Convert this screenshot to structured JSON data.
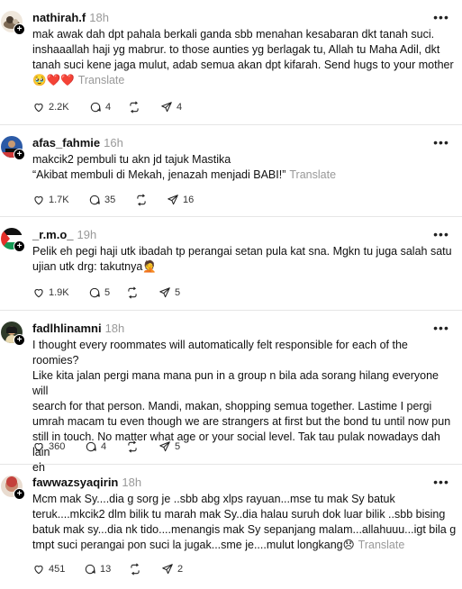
{
  "posts": [
    {
      "username": "nathirah.f",
      "time": "18h",
      "lines": [
        "mak awak dah dpt pahala berkali ganda sbb menahan kesabaran dkt tanah suci.",
        "inshaaallah haji yg mabrur. to those aunties yg berlagak tu, Allah tu Maha Adil, dkt",
        "tanah suci kene jaga mulut, adab semua akan dpt kifarah. Send hugs to your mother"
      ],
      "last_line": "🥹❤️❤️",
      "translate": "Translate",
      "likes": "2.2K",
      "replies": "4",
      "reposts": "",
      "shares": "4"
    },
    {
      "username": "afas_fahmie",
      "time": "16h",
      "lines": [
        "makcik2 pembuli tu akn jd tajuk Mastika"
      ],
      "last_line": "“Akibat membuli di Mekah, jenazah menjadi BABI!”",
      "translate": "Translate",
      "likes": "1.7K",
      "replies": "35",
      "reposts": "",
      "shares": "16"
    },
    {
      "username": "_r.m.o_",
      "time": "19h",
      "lines": [
        "Pelik eh pegi haji utk ibadah tp perangai setan pula kat sna. Mgkn tu juga salah satu"
      ],
      "last_line": "ujian utk drg: takutnya🤦",
      "translate": "",
      "likes": "1.9K",
      "replies": "5",
      "reposts": "",
      "shares": "5"
    },
    {
      "username": "fadlhlinamni",
      "time": "18h",
      "lines": [
        "I thought every roommates will automatically felt responsible for each of the roomies?",
        "Like kita jalan pergi mana mana pun in a group n bila ada sorang hilang everyone will",
        "search for that person. Mandi, makan, shopping semua together. Lastime I pergi",
        "umrah macam tu even though we are strangers at first but the bond tu until now pun",
        "still in touch. No matter what age or your social level. Tak tau pulak nowadays dah lain"
      ],
      "last_line": "eh",
      "translate": "",
      "likes": "360",
      "replies": "4",
      "reposts": "",
      "shares": "5"
    },
    {
      "username": "fawwazsyaqirin",
      "time": "18h",
      "lines": [
        "Mcm mak Sy....dia g sorg je ..sbb abg xlps rayuan...mse tu mak Sy batuk",
        "teruk....mkcik2 dlm bilik tu marah mak Sy..dia halau suruh dok luar bilik ..sbb bising",
        "batuk mak sy...dia nk tido....menangis mak Sy sepanjang malam...allahuuu...igt bila g"
      ],
      "last_line": "tmpt suci perangai pon suci la jugak...sme je....mulut longkang😞",
      "translate": "Translate",
      "likes": "451",
      "replies": "13",
      "reposts": "",
      "shares": "2"
    }
  ],
  "icons": {
    "like": "heart-icon",
    "reply": "comment-icon",
    "repost": "repost-icon",
    "share": "send-icon",
    "more": "more-icon",
    "follow": "follow-plus-icon"
  }
}
